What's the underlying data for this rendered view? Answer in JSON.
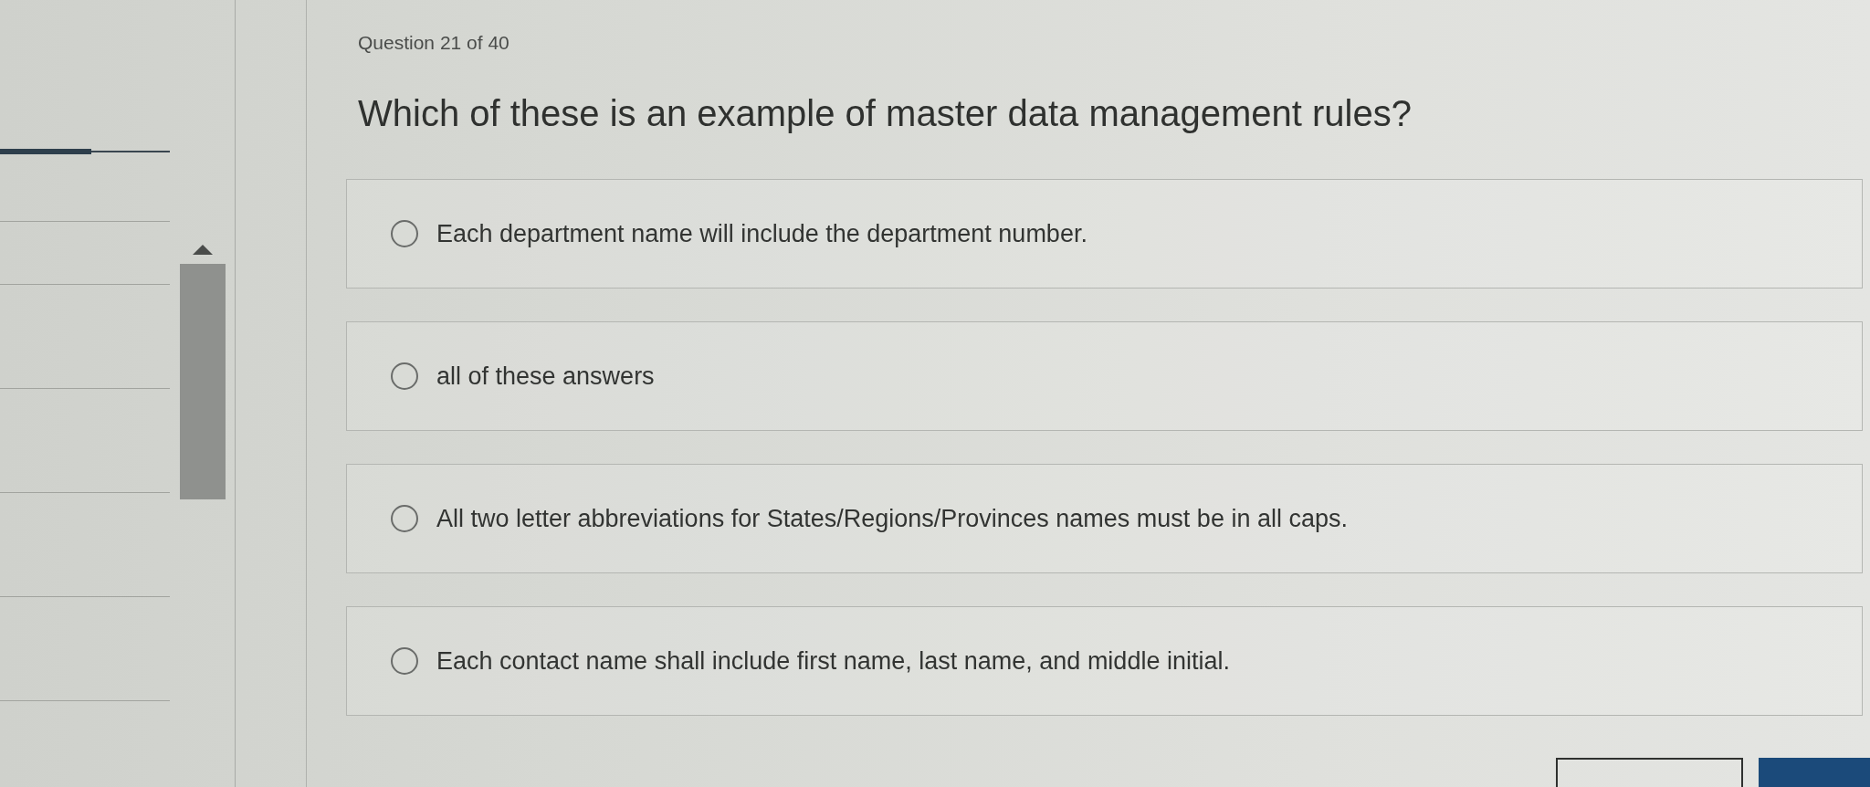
{
  "sidebar": {
    "progress": {
      "level": 0.54
    }
  },
  "question": {
    "counter": "Question 21 of 40",
    "text": "Which of these is an example of master data management rules?"
  },
  "options": [
    {
      "label": "Each department name will include the department number.",
      "selected": false
    },
    {
      "label": "all of these answers",
      "selected": false
    },
    {
      "label": "All two letter abbreviations for States/Regions/Provinces names must be in all caps.",
      "selected": false
    },
    {
      "label": "Each contact name shall include first name, last name, and middle initial.",
      "selected": false
    }
  ],
  "footer": {
    "buttons": [
      {
        "kind": "outline"
      },
      {
        "kind": "primary"
      }
    ]
  }
}
